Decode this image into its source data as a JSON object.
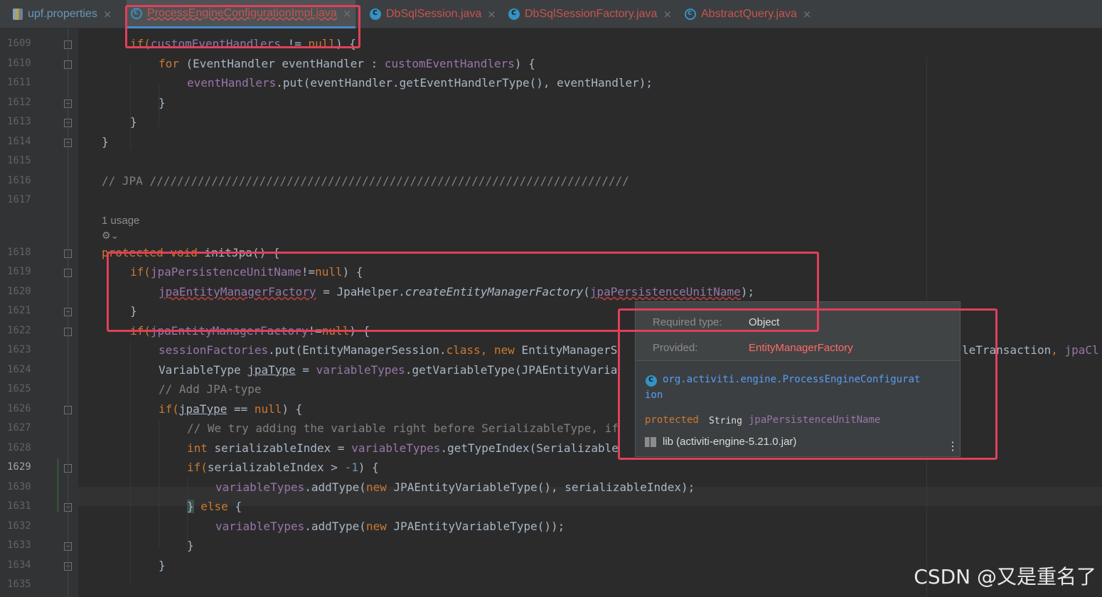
{
  "tabs": [
    {
      "label": "upf.properties",
      "icon": "properties-file-icon",
      "color": "#6897bb"
    },
    {
      "label": "ProcessEngineConfigurationImpl.java",
      "icon": "abstract-class-icon",
      "color": "#c75450"
    },
    {
      "label": "DbSqlSession.java",
      "icon": "class-icon",
      "color": "#c75450"
    },
    {
      "label": "DbSqlSessionFactory.java",
      "icon": "class-icon",
      "color": "#c75450"
    },
    {
      "label": "AbstractQuery.java",
      "icon": "abstract-class-icon",
      "color": "#c75450"
    }
  ],
  "close_glyph": "×",
  "line_numbers": [
    "1609",
    "1610",
    "1611",
    "1612",
    "1613",
    "1614",
    "1615",
    "1616",
    "1617",
    "1618",
    "1619",
    "1620",
    "1621",
    "1622",
    "1623",
    "1624",
    "1625",
    "1626",
    "1627",
    "1628",
    "1629",
    "1630",
    "1631",
    "1632",
    "1633",
    "1634",
    "1635"
  ],
  "current_line": "1629",
  "code": {
    "l1609": {
      "a": "if(",
      "b": "customEventHandlers",
      "c": " != ",
      "d": "null",
      "e": ") {"
    },
    "l1610": {
      "a": "for",
      "b": " (EventHandler eventHandler : ",
      "c": "customEventHandlers",
      "d": ") {"
    },
    "l1611": {
      "a": "eventHandlers",
      "b": ".put(eventHandler.getEventHandlerType(), eventHandler);"
    },
    "l1612": "}",
    "l1613": "}",
    "l1614": "}",
    "l1616": "// JPA //////////////////////////////////////////////////////////////////////",
    "usage": "1 usage",
    "l1618": {
      "a": "protected",
      "b": " ",
      "c": "void",
      "d": " initJpa() {"
    },
    "l1619": {
      "a": "if(",
      "b": "jpaPersistenceUnitName",
      "c": "!=",
      "d": "null",
      "e": ") {"
    },
    "l1620": {
      "a": "jpaEntityManagerFactory",
      "b": " = JpaHelper.",
      "c": "createEntityManagerFactory",
      "d": "(",
      "e": "jpaPersistenceUnitName",
      "f": ");"
    },
    "l1621": "}",
    "l1622": {
      "a": "if(",
      "b": "jpaEntityManagerFactory",
      "c": "!=",
      "d": "null",
      "e": ") {"
    },
    "l1623": {
      "a": "sessionFactories",
      "b": ".put(EntityManagerSession.",
      "c": "class",
      "d": ", ",
      "e": "new",
      "f": " EntityManagerS"
    },
    "l1623_tail": {
      "a": "leTransaction",
      "b": ", ",
      "c": "jpaCl"
    },
    "l1624": {
      "a": "VariableType ",
      "b": "jpaType",
      "c": " = ",
      "d": "variableTypes",
      "e": ".getVariableType(JPAEntityVaria"
    },
    "l1625": "// Add JPA-type",
    "l1626": {
      "a": "if(",
      "b": "jpaType",
      "c": " == ",
      "d": "null",
      "e": ") {"
    },
    "l1627": "// We try adding the variable right before SerializableType, if",
    "l1628": {
      "a": "int",
      "b": " serializableIndex = ",
      "c": "variableTypes",
      "d": ".getTypeIndex(Serializable"
    },
    "l1629": {
      "a": "if(",
      "b": "serializableIndex > ",
      "c": "-1",
      "d": ") {"
    },
    "l1630": {
      "a": "variableTypes",
      "b": ".addType(",
      "c": "new",
      "d": " JPAEntityVariableType(), serializableIndex);"
    },
    "l1631": {
      "a": "}",
      "b": " else",
      "c": " {"
    },
    "l1632": {
      "a": "variableTypes",
      "b": ".addType(",
      "c": "new",
      "d": " JPAEntityVariableType());"
    },
    "l1633": "}",
    "l1634": "}"
  },
  "popup": {
    "required_label": "Required type:",
    "required_value": "Object",
    "provided_label": "Provided:",
    "provided_value": "EntityManagerFactory",
    "class_line1": "org.activiti.engine.ProcessEngineConfigurat",
    "class_line2": "ion",
    "modifier": "protected",
    "type": "String",
    "field": "jpaPersistenceUnitName",
    "lib": "lib (activiti-engine-5.21.0.jar)",
    "more": "⋮"
  },
  "watermark": "CSDN @又是重名了",
  "colors": {
    "highlight": "#e0405a",
    "keyword": "#cc7832",
    "field": "#9876aa",
    "comment": "#808080",
    "error": "#ff6b68",
    "link": "#589df6"
  }
}
